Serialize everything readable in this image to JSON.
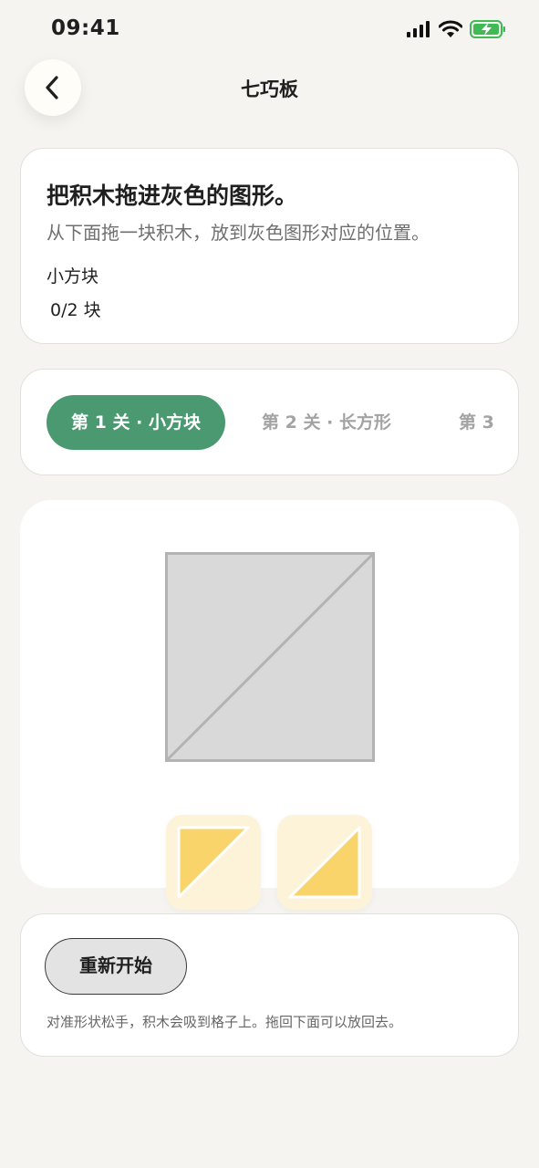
{
  "status_bar": {
    "time": "09:41"
  },
  "nav": {
    "title": "七巧板",
    "back_icon": "chevron-left-icon"
  },
  "instruction": {
    "title": "把积木拖进灰色的图形。",
    "subtitle": "从下面拖一块积木，放到灰色图形对应的位置。",
    "shape_name": "小方块",
    "progress": "0/2 块"
  },
  "levels": [
    {
      "label": "第 1 关 · 小方块",
      "selected": true
    },
    {
      "label": "第 2 关 · 长方形",
      "selected": false
    },
    {
      "label": "第 3",
      "selected": false
    }
  ],
  "board": {
    "target_shape": "square split diagonally into two triangles",
    "pieces": [
      "yellow-triangle-top-left",
      "yellow-triangle-bottom-right"
    ]
  },
  "controls": {
    "restart_label": "重新开始",
    "hint": "对准形状松手，积木会吸到格子上。拖回下面可以放回去。"
  },
  "colors": {
    "accent": "#4a9970",
    "piece_fill": "#f8d46a",
    "piece_tile": "#fdf3d9",
    "target_fill": "#d9d9d9",
    "background": "#f5f4f0"
  }
}
